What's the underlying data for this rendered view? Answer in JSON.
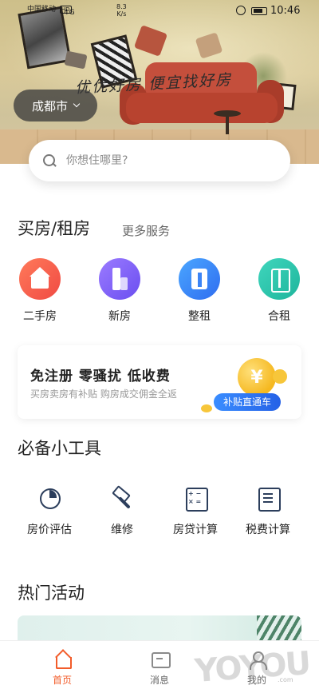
{
  "status_bar": {
    "carrier": "中国移动",
    "hd_badge": "HD",
    "signal": "4G",
    "speed_value": "8.3",
    "speed_unit": "K/s",
    "time": "10:46"
  },
  "hero": {
    "slogan": "优优好房 便宜找好房",
    "city": "成都市"
  },
  "search": {
    "placeholder": "你想住哪里?"
  },
  "section_buy_rent": {
    "title": "买房/租房",
    "more_link": "更多服务",
    "categories": [
      {
        "label": "二手房",
        "icon": "house-icon",
        "color": "#f04a43"
      },
      {
        "label": "新房",
        "icon": "building-icon",
        "color": "#6a4ef0"
      },
      {
        "label": "整租",
        "icon": "whole-rent-icon",
        "color": "#2f6df0"
      },
      {
        "label": "合租",
        "icon": "shared-rent-icon",
        "color": "#1fb59c"
      }
    ]
  },
  "promo": {
    "title": "免注册 零骚扰 低收费",
    "subtitle": "买房卖房有补贴 购房成交佣金全返",
    "coin_symbol": "¥",
    "badge": "补贴直通车"
  },
  "tools": {
    "title": "必备小工具",
    "items": [
      {
        "label": "房价评估",
        "icon": "pie-chart-icon"
      },
      {
        "label": "维修",
        "icon": "hammer-icon"
      },
      {
        "label": "房贷计算",
        "icon": "calculator-icon"
      },
      {
        "label": "税费计算",
        "icon": "tax-list-icon"
      }
    ]
  },
  "activities": {
    "title": "热门活动"
  },
  "tab_bar": {
    "tabs": [
      {
        "label": "首页",
        "icon": "home-icon",
        "active": true
      },
      {
        "label": "消息",
        "icon": "message-icon",
        "active": false
      },
      {
        "label": "我的",
        "icon": "profile-icon",
        "active": false
      }
    ]
  },
  "watermark": {
    "text": "YOYOU",
    "sub": ".com"
  },
  "colors": {
    "accent": "#f25c2a",
    "promo_badge": "#2561e6",
    "coin": "#f5b820"
  }
}
